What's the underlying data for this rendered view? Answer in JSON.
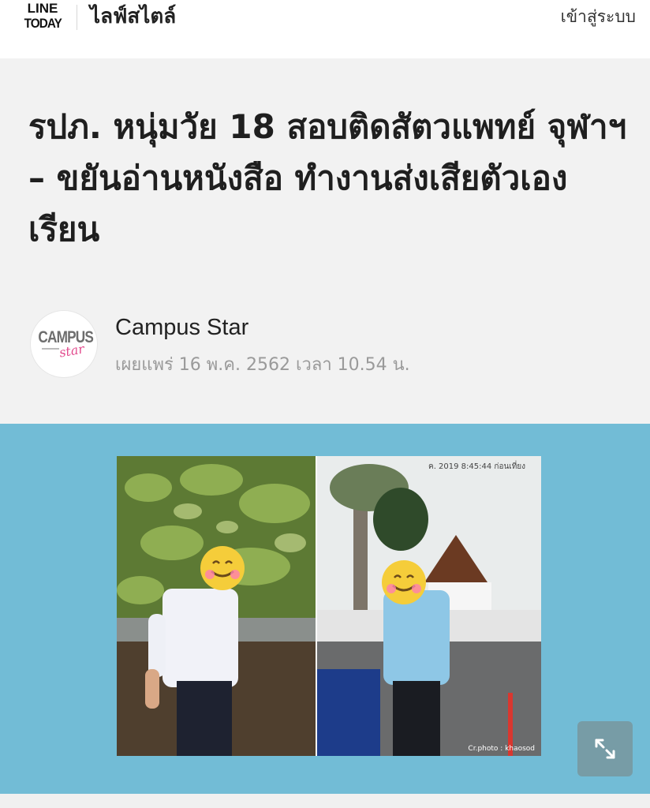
{
  "header": {
    "logo_line1": "LINE",
    "logo_line2": "TODAY",
    "section": "ไลฟ์สไตล์",
    "login": "เข้าสู่ระบบ"
  },
  "article": {
    "headline": "รปภ. หนุ่มวัย 18 สอบติดสัตวแพทย์ จุฬาฯ – ขยันอ่านหนังสือ ทำงานส่งเสียตัวเองเรียน",
    "author_logo_text": "CAMPUS",
    "author_logo_script": "star",
    "author": "Campus Star",
    "published": "เผยแพร่ 16 พ.ค. 2562 เวลา 10.54 น."
  },
  "image": {
    "stamp": "ค. 2019 8:45:44 ก่อนเที่ยง",
    "credit": "Cr.photo : khaosod",
    "expand_icon": "expand-icon"
  },
  "colors": {
    "image_band": "#72bcd6",
    "background": "#f2f2f2",
    "date_text": "#9a9a9a"
  }
}
